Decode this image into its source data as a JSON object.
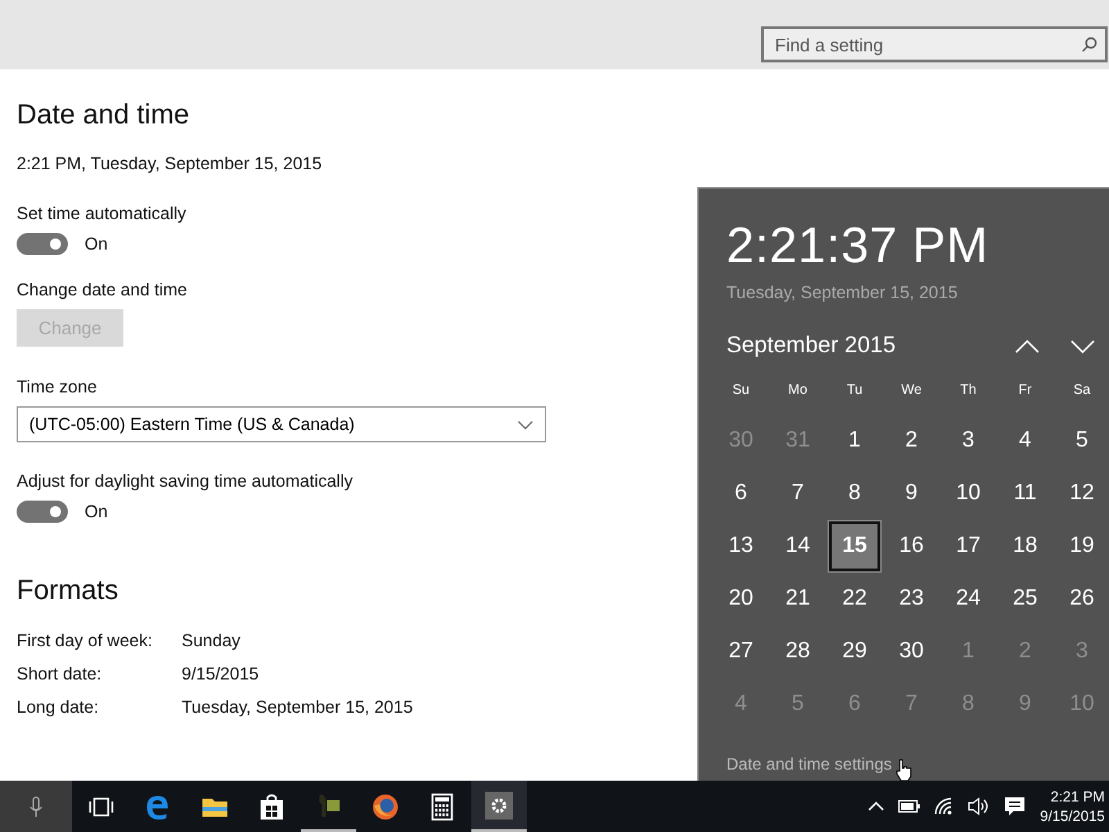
{
  "header": {
    "search": {
      "placeholder": "Find a setting"
    }
  },
  "settings": {
    "title": "Date and time",
    "current": "2:21 PM, Tuesday, September 15, 2015",
    "set_auto": {
      "label": "Set time automatically",
      "on": true,
      "state_text": "On"
    },
    "change": {
      "label": "Change date and time",
      "button": "Change",
      "disabled": true
    },
    "time_zone": {
      "label": "Time zone",
      "value": "(UTC-05:00) Eastern Time (US & Canada)"
    },
    "dst": {
      "label": "Adjust for daylight saving time automatically",
      "on": true,
      "state_text": "On"
    },
    "formats": {
      "title": "Formats",
      "rows": [
        {
          "label": "First day of week:",
          "value": "Sunday"
        },
        {
          "label": "Short date:",
          "value": "9/15/2015"
        },
        {
          "label": "Long date:",
          "value": "Tuesday, September 15, 2015"
        }
      ]
    }
  },
  "flyout": {
    "time": "2:21:37 PM",
    "date": "Tuesday, September 15, 2015",
    "month": "September 2015",
    "weekdays": [
      "Su",
      "Mo",
      "Tu",
      "We",
      "Th",
      "Fr",
      "Sa"
    ],
    "days": [
      {
        "label": "30",
        "in_month": false,
        "selected": false
      },
      {
        "label": "31",
        "in_month": false,
        "selected": false
      },
      {
        "label": "1",
        "in_month": true,
        "selected": false
      },
      {
        "label": "2",
        "in_month": true,
        "selected": false
      },
      {
        "label": "3",
        "in_month": true,
        "selected": false
      },
      {
        "label": "4",
        "in_month": true,
        "selected": false
      },
      {
        "label": "5",
        "in_month": true,
        "selected": false
      },
      {
        "label": "6",
        "in_month": true,
        "selected": false
      },
      {
        "label": "7",
        "in_month": true,
        "selected": false
      },
      {
        "label": "8",
        "in_month": true,
        "selected": false
      },
      {
        "label": "9",
        "in_month": true,
        "selected": false
      },
      {
        "label": "10",
        "in_month": true,
        "selected": false
      },
      {
        "label": "11",
        "in_month": true,
        "selected": false
      },
      {
        "label": "12",
        "in_month": true,
        "selected": false
      },
      {
        "label": "13",
        "in_month": true,
        "selected": false
      },
      {
        "label": "14",
        "in_month": true,
        "selected": false
      },
      {
        "label": "15",
        "in_month": true,
        "selected": true
      },
      {
        "label": "16",
        "in_month": true,
        "selected": false
      },
      {
        "label": "17",
        "in_month": true,
        "selected": false
      },
      {
        "label": "18",
        "in_month": true,
        "selected": false
      },
      {
        "label": "19",
        "in_month": true,
        "selected": false
      },
      {
        "label": "20",
        "in_month": true,
        "selected": false
      },
      {
        "label": "21",
        "in_month": true,
        "selected": false
      },
      {
        "label": "22",
        "in_month": true,
        "selected": false
      },
      {
        "label": "23",
        "in_month": true,
        "selected": false
      },
      {
        "label": "24",
        "in_month": true,
        "selected": false
      },
      {
        "label": "25",
        "in_month": true,
        "selected": false
      },
      {
        "label": "26",
        "in_month": true,
        "selected": false
      },
      {
        "label": "27",
        "in_month": true,
        "selected": false
      },
      {
        "label": "28",
        "in_month": true,
        "selected": false
      },
      {
        "label": "29",
        "in_month": true,
        "selected": false
      },
      {
        "label": "30",
        "in_month": true,
        "selected": false
      },
      {
        "label": "1",
        "in_month": false,
        "selected": false
      },
      {
        "label": "2",
        "in_month": false,
        "selected": false
      },
      {
        "label": "3",
        "in_month": false,
        "selected": false
      },
      {
        "label": "4",
        "in_month": false,
        "selected": false
      },
      {
        "label": "5",
        "in_month": false,
        "selected": false
      },
      {
        "label": "6",
        "in_month": false,
        "selected": false
      },
      {
        "label": "7",
        "in_month": false,
        "selected": false
      },
      {
        "label": "8",
        "in_month": false,
        "selected": false
      },
      {
        "label": "9",
        "in_month": false,
        "selected": false
      },
      {
        "label": "10",
        "in_month": false,
        "selected": false
      }
    ],
    "link": "Date and time settings"
  },
  "taskbar": {
    "apps": [
      {
        "kind": "taskview",
        "running": false,
        "active": false
      },
      {
        "kind": "edge",
        "running": false,
        "active": false
      },
      {
        "kind": "explorer",
        "running": false,
        "active": false
      },
      {
        "kind": "store",
        "running": false,
        "active": false
      },
      {
        "kind": "app",
        "running": true,
        "active": false
      },
      {
        "kind": "firefox",
        "running": false,
        "active": false
      },
      {
        "kind": "calculator",
        "running": false,
        "active": false
      },
      {
        "kind": "settings",
        "running": true,
        "active": true
      }
    ],
    "clock_time": "2:21 PM",
    "clock_date": "9/15/2015"
  }
}
